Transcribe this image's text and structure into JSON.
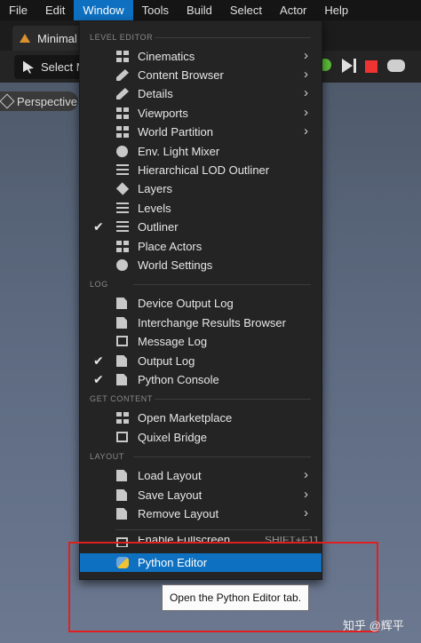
{
  "menubar": {
    "items": [
      "File",
      "Edit",
      "Window",
      "Tools",
      "Build",
      "Select",
      "Actor",
      "Help"
    ],
    "active": "Window"
  },
  "tab": {
    "label": "Minimal"
  },
  "toolbar": {
    "select_mode": "Select M"
  },
  "viewport": {
    "mode": "Perspective"
  },
  "dropdown": {
    "sections": {
      "level_editor": "LEVEL EDITOR",
      "log": "LOG",
      "get_content": "GET CONTENT",
      "layout": "LAYOUT"
    },
    "level_editor_items": [
      {
        "label": "Cinematics",
        "icon": "clapper-icon",
        "submenu": true,
        "checked": false
      },
      {
        "label": "Content Browser",
        "icon": "folder-icon",
        "submenu": true,
        "checked": false
      },
      {
        "label": "Details",
        "icon": "details-icon",
        "submenu": true,
        "checked": false
      },
      {
        "label": "Viewports",
        "icon": "viewports-icon",
        "submenu": true,
        "checked": false
      },
      {
        "label": "World Partition",
        "icon": "world-partition-icon",
        "submenu": true,
        "checked": false
      },
      {
        "label": "Env. Light Mixer",
        "icon": "light-mixer-icon",
        "submenu": false,
        "checked": false
      },
      {
        "label": "Hierarchical LOD Outliner",
        "icon": "hlod-icon",
        "submenu": false,
        "checked": false
      },
      {
        "label": "Layers",
        "icon": "layers-icon",
        "submenu": false,
        "checked": false
      },
      {
        "label": "Levels",
        "icon": "levels-icon",
        "submenu": false,
        "checked": false
      },
      {
        "label": "Outliner",
        "icon": "outliner-icon",
        "submenu": false,
        "checked": true
      },
      {
        "label": "Place Actors",
        "icon": "place-actors-icon",
        "submenu": false,
        "checked": false
      },
      {
        "label": "World Settings",
        "icon": "world-settings-icon",
        "submenu": false,
        "checked": false
      }
    ],
    "log_items": [
      {
        "label": "Device Output Log",
        "icon": "log-icon",
        "checked": false
      },
      {
        "label": "Interchange Results Browser",
        "icon": "log-icon",
        "checked": false
      },
      {
        "label": "Message Log",
        "icon": "message-log-icon",
        "checked": false
      },
      {
        "label": "Output Log",
        "icon": "output-log-icon",
        "checked": true
      },
      {
        "label": "Python Console",
        "icon": "console-icon",
        "checked": true
      }
    ],
    "content_items": [
      {
        "label": "Open Marketplace",
        "icon": "marketplace-icon"
      },
      {
        "label": "Quixel Bridge",
        "icon": "bridge-icon"
      }
    ],
    "layout_items": [
      {
        "label": "Load Layout",
        "icon": "load-layout-icon",
        "submenu": true
      },
      {
        "label": "Save Layout",
        "icon": "save-layout-icon",
        "submenu": true
      },
      {
        "label": "Remove Layout",
        "icon": "remove-layout-icon",
        "submenu": true
      }
    ],
    "fullscreen": {
      "label": "Enable Fullscreen",
      "shortcut": "SHIFT+F11"
    },
    "python_editor": {
      "label": "Python Editor"
    }
  },
  "tooltip": {
    "text": "Open the Python Editor tab."
  },
  "watermark": {
    "text": "知乎 @辉平"
  },
  "colors": {
    "highlight": "#0e70c0",
    "annotation": "#e02020",
    "menu_bg": "#242424"
  }
}
